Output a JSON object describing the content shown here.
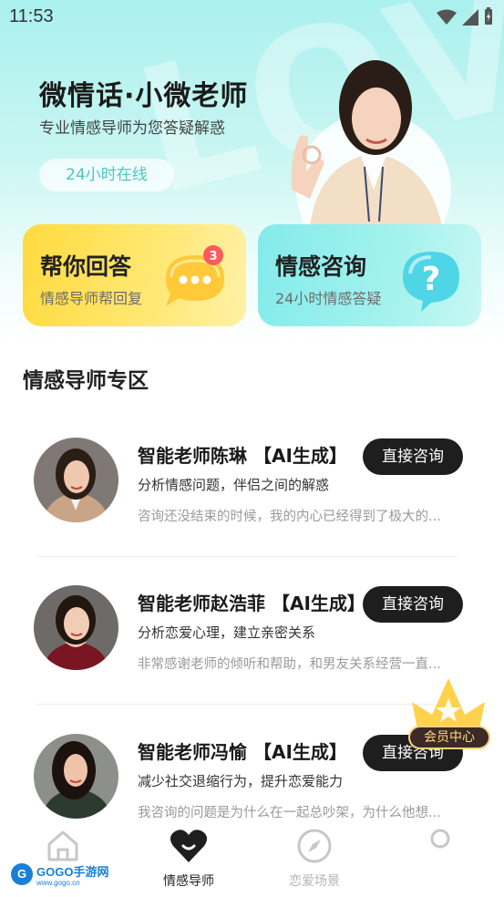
{
  "status_bar": {
    "time": "11:53"
  },
  "hero": {
    "background_text": "LOVE",
    "title": "微情话·小微老师",
    "subtitle": "专业情感导师为您答疑解惑",
    "online_badge": "24小时在线"
  },
  "cards": [
    {
      "title": "帮你回答",
      "subtitle": "情感导师帮回复",
      "icon": "chat-bubble-icon",
      "badge": "3",
      "color": "#ffdb3f"
    },
    {
      "title": "情感咨询",
      "subtitle": "24小时情感答疑",
      "icon": "question-bubble-icon",
      "color": "#83ebea"
    }
  ],
  "section": {
    "title": "情感导师专区"
  },
  "teachers": [
    {
      "name": "智能老师陈琳 【AI生成】",
      "description": "分析情感问题，伴侣之间的解惑",
      "review": "咨询还没结束的时候，我的内心已经得到了极大的...",
      "button": "直接咨询"
    },
    {
      "name": "智能老师赵浩菲 【AI生成】",
      "description": "分析恋爱心理，建立亲密关系",
      "review": "非常感谢老师的倾听和帮助，和男友关系经营一直...",
      "button": "直接咨询"
    },
    {
      "name": "智能老师冯愉 【AI生成】",
      "description": "减少社交退缩行为，提升恋爱能力",
      "review": "我咨询的问题是为什么在一起总吵架，为什么他想...",
      "button": "直接咨询"
    }
  ],
  "vip": {
    "label": "会员中心",
    "icon": "crown-icon"
  },
  "tab_bar": {
    "tabs": [
      {
        "label": "",
        "icon": "home-icon",
        "active": false
      },
      {
        "label": "情感导师",
        "icon": "heart-icon",
        "active": true
      },
      {
        "label": "恋爱场景",
        "icon": "compass-icon",
        "active": false
      },
      {
        "label": "",
        "icon": "profile-icon",
        "active": false
      }
    ]
  },
  "watermark": {
    "brand": "GOGO手游网",
    "url": "www.gogo.cn",
    "logo_letter": "G"
  },
  "colors": {
    "accent_teal": "#48c7c3",
    "button_dark": "#1e1e1e",
    "vip_gold": "#f6d27a"
  }
}
